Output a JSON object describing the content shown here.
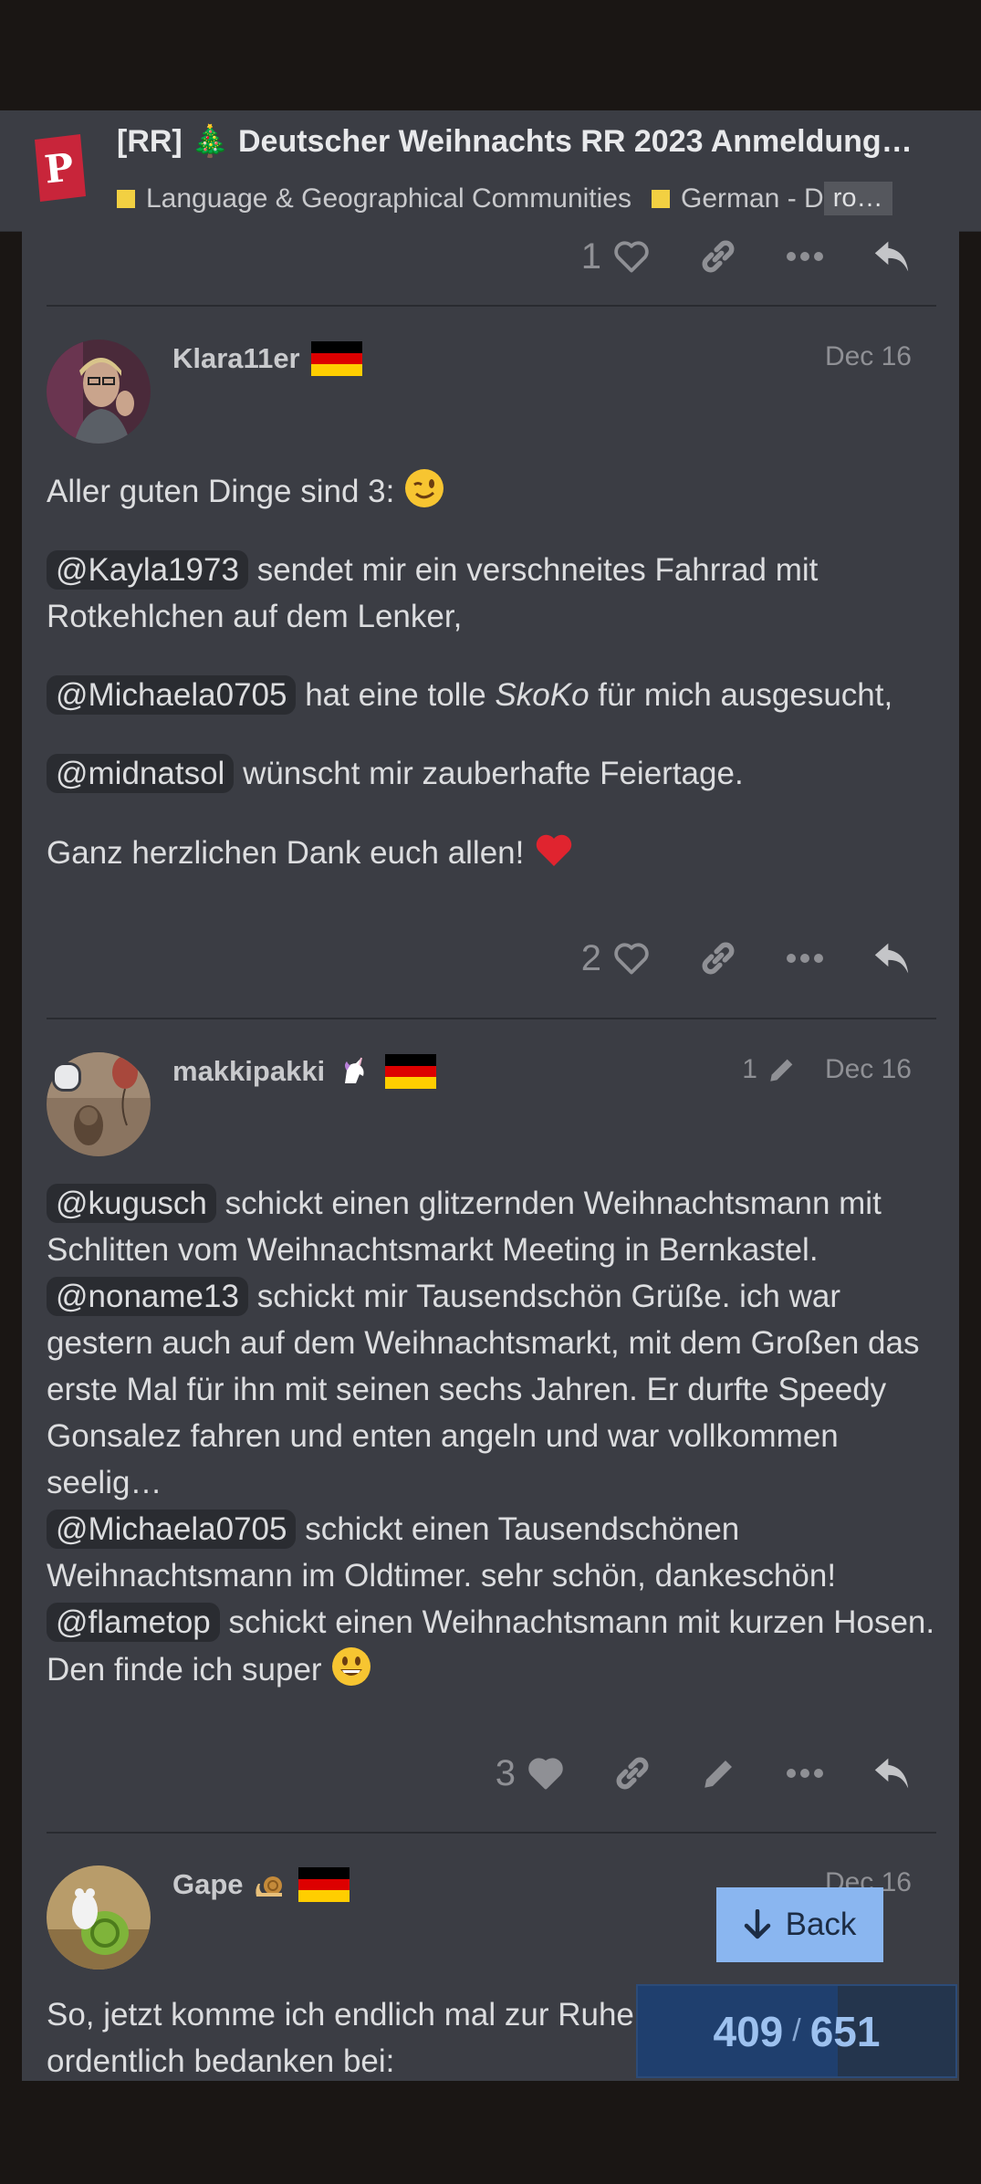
{
  "header": {
    "title": "[RR] 🎄 Deutscher Weihnachts RR 2023 Anmeldung…",
    "breadcrumbs": [
      "Language & Geographical Communities",
      "German - D"
    ],
    "crumb_more": "ro…",
    "category_color": "#f2d042"
  },
  "previous_post": {
    "like_count": "1"
  },
  "posts": [
    {
      "username": "Klara11er",
      "date": "Dec 16",
      "like_count": "2",
      "p1": "Aller guten Dinge sind 3:",
      "m1": "@Kayla1973",
      "t1": "sendet mir ein verschneites Fahrrad mit Rotkehlchen auf dem Lenker,",
      "m2": "@Michaela0705",
      "t2a": "hat eine tolle",
      "t2em": "SkoKo",
      "t2b": "für mich ausgesucht,",
      "m3": "@midnatsol",
      "t3": "wünscht mir zauberhafte Feiertage.",
      "p5": "Ganz herzlichen Dank euch allen!"
    },
    {
      "username": "makkipakki",
      "edit_count": "1",
      "date": "Dec 16",
      "like_count": "3",
      "m1": "@kugusch",
      "t1": "schickt einen glitzernden Weihnachtsmann mit Schlitten vom Weihnachtsmarkt Meeting in Bernkastel.",
      "m2": "@noname13",
      "t2": "schickt mir Tausendschön Grüße. ich war gestern auch auf dem Weihnachtsmarkt, mit dem Großen das erste Mal für ihn mit seinen sechs Jahren. Er durfte Speedy Gonsalez fahren und enten angeln und war vollkommen seelig…",
      "m3": "@Michaela0705",
      "t3": "schickt einen Tausendschönen Weihnachtsmann im Oldtimer. sehr schön, dankeschön!",
      "m4": "@flametop",
      "t4": "schickt einen Weihnachtsmann mit kurzen Hosen. Den finde ich super"
    },
    {
      "username": "Gape",
      "date": "Dec 16",
      "text": "So, jetzt komme ich endlich mal zur Ruhe ordentlich bedanken bei:"
    }
  ],
  "back_label": "Back",
  "progress": {
    "current": "409",
    "separator": "/",
    "total": "651",
    "fraction": 0.628
  }
}
